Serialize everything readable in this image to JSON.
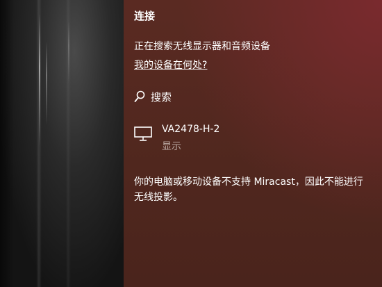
{
  "panel": {
    "title": "连接",
    "status": "正在搜索无线显示器和音频设备",
    "help_link": "我的设备在何处?",
    "search_label": "搜索",
    "device": {
      "name": "VA2478-H-2",
      "type": "显示",
      "icon": "monitor-icon"
    },
    "message_line1": "你的电脑或移动设备不支持 Miracast，因此不能进行",
    "message_line2": "无线投影。"
  },
  "colors": {
    "panel_background": "#52281f",
    "text": "#ffffff",
    "secondary_text": "#b9a6a1"
  }
}
